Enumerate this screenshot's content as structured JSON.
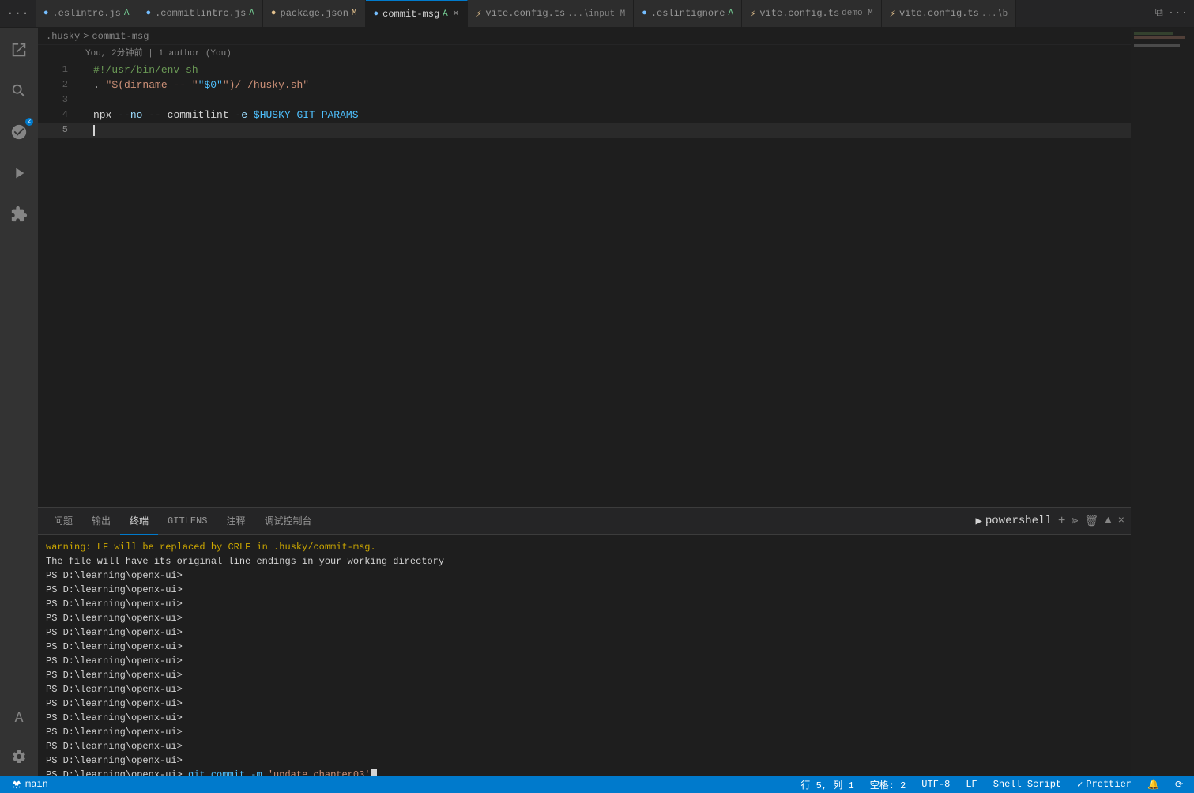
{
  "tabs": [
    {
      "id": "eslintrc-js",
      "label": ".eslintrc.js",
      "suffix": "A",
      "active": false,
      "icon": "circle",
      "iconColor": "#75beff",
      "modified": false
    },
    {
      "id": "commitlintrc-js",
      "label": ".commitlintrc.js",
      "suffix": "A",
      "active": false,
      "icon": "circle",
      "iconColor": "#75beff",
      "modified": false
    },
    {
      "id": "package-json",
      "label": "package.json",
      "suffix": "M",
      "active": false,
      "icon": "circle",
      "iconColor": "#e2c08d",
      "modified": true
    },
    {
      "id": "commit-msg",
      "label": "commit-msg",
      "suffix": "A",
      "active": true,
      "icon": "circle",
      "iconColor": "#75beff",
      "modified": false,
      "closable": true
    },
    {
      "id": "vite-config-input",
      "label": "vite.config.ts",
      "sublabel": "...\\input M",
      "active": false,
      "icon": "lightning",
      "iconColor": "#e2c08d",
      "modified": true
    },
    {
      "id": "eslintignore",
      "label": ".eslintignore",
      "suffix": "A",
      "active": false,
      "icon": "circle",
      "iconColor": "#75beff",
      "modified": false
    },
    {
      "id": "vite-config-demo",
      "label": "vite.config.ts",
      "sublabel": "demo M",
      "active": false,
      "icon": "lightning",
      "iconColor": "#e2c08d",
      "modified": true
    },
    {
      "id": "vite-config-b",
      "label": "vite.config.ts",
      "sublabel": "...\\b",
      "active": false,
      "icon": "lightning",
      "iconColor": "#e2c08d",
      "modified": false
    }
  ],
  "breadcrumb": {
    "folder": ".husky",
    "separator": ">",
    "file": "commit-msg"
  },
  "git_blame": "You, 2分钟前  |  1 author (You)",
  "code_lines": [
    {
      "num": 1,
      "content": "#!/usr/bin/env sh",
      "type": "shebang"
    },
    {
      "num": 2,
      "content": ". \"$(dirname -- \"$0\")/_/husky.sh\"",
      "type": "source"
    },
    {
      "num": 3,
      "content": "",
      "type": "empty"
    },
    {
      "num": 4,
      "content": "npx --no -- commitlint -e $HUSKY_GIT_PARAMS",
      "type": "command"
    },
    {
      "num": 5,
      "content": "",
      "type": "empty"
    }
  ],
  "panel": {
    "tabs": [
      {
        "id": "problems",
        "label": "问题",
        "active": false
      },
      {
        "id": "output",
        "label": "输出",
        "active": false
      },
      {
        "id": "terminal",
        "label": "终端",
        "active": true
      },
      {
        "id": "gitlens",
        "label": "GITLENS",
        "active": false
      },
      {
        "id": "comments",
        "label": "注释",
        "active": false
      },
      {
        "id": "debug-console",
        "label": "调试控制台",
        "active": false
      }
    ],
    "shell_label": "powershell",
    "terminal_lines": [
      {
        "type": "warning",
        "text": "warning: LF will be replaced by CRLF in .husky/commit-msg."
      },
      {
        "type": "info",
        "text": "The file will have its original line endings in your working directory"
      },
      {
        "type": "prompt",
        "text": "PS D:\\learning\\openx-ui>"
      },
      {
        "type": "prompt",
        "text": "PS D:\\learning\\openx-ui>"
      },
      {
        "type": "prompt",
        "text": "PS D:\\learning\\openx-ui>"
      },
      {
        "type": "prompt",
        "text": "PS D:\\learning\\openx-ui>"
      },
      {
        "type": "prompt",
        "text": "PS D:\\learning\\openx-ui>"
      },
      {
        "type": "prompt",
        "text": "PS D:\\learning\\openx-ui>"
      },
      {
        "type": "prompt",
        "text": "PS D:\\learning\\openx-ui>"
      },
      {
        "type": "prompt",
        "text": "PS D:\\learning\\openx-ui>"
      },
      {
        "type": "prompt",
        "text": "PS D:\\learning\\openx-ui>"
      },
      {
        "type": "prompt",
        "text": "PS D:\\learning\\openx-ui>"
      },
      {
        "type": "prompt",
        "text": "PS D:\\learning\\openx-ui>"
      },
      {
        "type": "prompt",
        "text": "PS D:\\learning\\openx-ui>"
      },
      {
        "type": "prompt",
        "text": "PS D:\\learning\\openx-ui>"
      },
      {
        "type": "prompt",
        "text": "PS D:\\learning\\openx-ui>"
      },
      {
        "type": "prompt",
        "text": "PS D:\\learning\\openx-ui>"
      },
      {
        "type": "cmd",
        "text": "PS D:\\learning\\openx-ui> git commit -m 'update chapter03'",
        "cursor": true
      }
    ]
  },
  "status_bar": {
    "left": [
      {
        "id": "remote",
        "text": "⎇ main",
        "icon": "branch"
      }
    ],
    "right": [
      {
        "id": "position",
        "text": "行 5, 列 1"
      },
      {
        "id": "spaces",
        "text": "空格: 2"
      },
      {
        "id": "encoding",
        "text": "UTF-8"
      },
      {
        "id": "line-ending",
        "text": "LF"
      },
      {
        "id": "language",
        "text": "Shell Script"
      },
      {
        "id": "prettier",
        "text": "✓ Prettier"
      },
      {
        "id": "bell",
        "text": "🔔"
      },
      {
        "id": "sync",
        "text": "⟳"
      }
    ]
  },
  "activity_icons": [
    {
      "id": "explorer",
      "icon": "📄",
      "active": false
    },
    {
      "id": "search",
      "icon": "🔍",
      "active": false
    },
    {
      "id": "git",
      "icon": "⎇",
      "active": false
    },
    {
      "id": "debug",
      "icon": "▷",
      "active": false
    },
    {
      "id": "extensions",
      "icon": "⊞",
      "active": false
    }
  ]
}
